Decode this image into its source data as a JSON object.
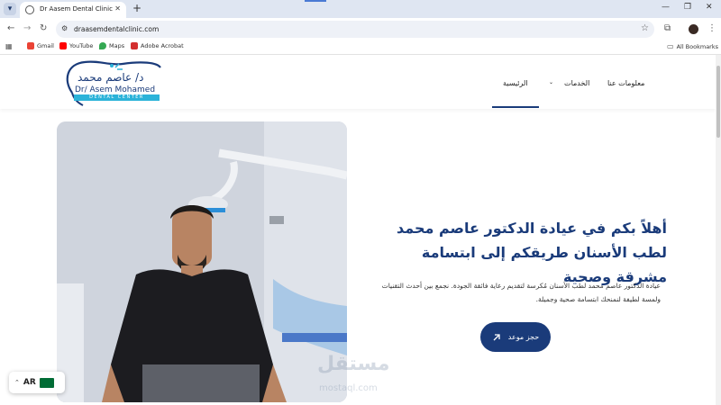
{
  "browser": {
    "tab_title": "Dr Aasem Dental Clinic",
    "url": "draasemdentalclinic.com",
    "bookmarks": [
      "Gmail",
      "YouTube",
      "Maps",
      "Adobe Acrobat"
    ],
    "all_bookmarks_label": "All Bookmarks"
  },
  "site": {
    "logo": {
      "arabic_name": "د/ عاصم محمد",
      "english_name": "Dr/ Asem Mohamed",
      "subtitle": "DENTAL CENTER"
    },
    "nav": {
      "about": "معلومات عنا",
      "services": "الخدمات",
      "home": "الرئيسية"
    },
    "hero": {
      "title": "أهلاً بكم في عيادة الدكتور عاصم محمد لطب الأسنان طريقكم إلى ابتسامة مشرقة وصحية",
      "description": "عيادة الدكتور عاصم محمد لطب الأسنان مُكرسة لتقديم رعاية فائقة الجودة. نجمع بين أحدث التقنيات ولمسة لطيفة لنمنحك ابتسامة صحية وجميلة.",
      "cta_label": "حجز موعد"
    },
    "language": {
      "code": "AR"
    },
    "watermark": {
      "arabic": "مستقل",
      "latin": "mostaql.com"
    }
  },
  "colors": {
    "brand": "#1a3b7a",
    "accent": "#2bb3d9"
  },
  "icons": {
    "cta": "arrow-up-right-icon",
    "services_dropdown": "chevron-down-icon",
    "language": "chevron-up-icon"
  }
}
